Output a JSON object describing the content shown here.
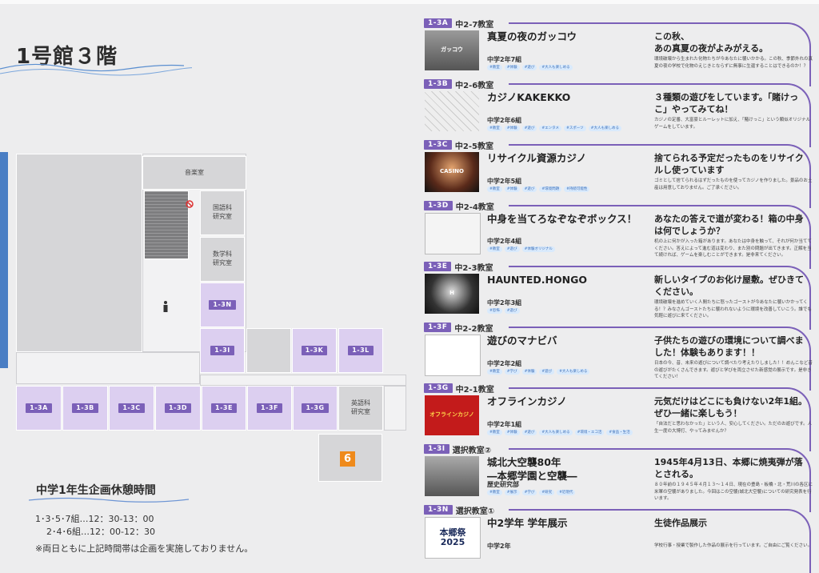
{
  "floor_title": "1号館３階",
  "colors": {
    "accent": "#7b60b8",
    "room_tag": "#dccff0",
    "marker": "#ef8a1b",
    "blue": "#4a7ec4"
  },
  "map": {
    "rooms": {
      "music": "音楽室",
      "japanese": "国語科\n研究室",
      "math": "数学科\n研究室",
      "english": "英語科\n研究室"
    },
    "tags": [
      "1-3N",
      "1-3I",
      "1-3K",
      "1-3L",
      "1-3A",
      "1-3B",
      "1-3C",
      "1-3D",
      "1-3E",
      "1-3F",
      "1-3G"
    ],
    "marker": "6",
    "icons": [
      "person-icon",
      "no-entry-icon"
    ]
  },
  "break_info": {
    "title": "中学1年生企画休憩時間",
    "line1": "1･3･5･7組…12：30-13：00",
    "line2": "2･4･6組…12：00-12：30",
    "note": "※両日ともに上記時間帯は企画を実施しておりません。"
  },
  "entries": [
    {
      "tag": "1-3A",
      "room": "中2-7教室",
      "title": "真夏の夜のガッコウ",
      "cls": "中学2年7組",
      "chips": [
        "#教室",
        "#体験",
        "#遊び",
        "#大人も楽しめる"
      ],
      "headline": "この秋、\nあの真夏の夜がよみがえる。",
      "desc": "環境破壊から生まれた化物たちが今あなたに襲いかかる。この秋、季節外れの真夏の夜の学校で化物のえじきとならずに無事に生還することはできるのか！？",
      "thumb_text": "ガッコウ"
    },
    {
      "tag": "1-3B",
      "room": "中2-6教室",
      "title": "カジノKAKEKKO",
      "cls": "中学2年6組",
      "chips": [
        "#教室",
        "#体験",
        "#遊び",
        "#エンタメ",
        "#スポーツ",
        "#大人も楽しめる"
      ],
      "headline": "３種類の遊びをしています。「賭けっこ」やってみてね！",
      "desc": "カジノの定番、大富豪とルーレットに加え、「賭けっこ」という類似オリジナルゲームをしています。",
      "thumb_text": ""
    },
    {
      "tag": "1-3C",
      "room": "中2-5教室",
      "title": "リサイクル資源カジノ",
      "cls": "中学2年5組",
      "chips": [
        "#教室",
        "#体験",
        "#遊び",
        "#環境問題",
        "#持続可能性"
      ],
      "headline": "捨てられる予定だったものをリサイクルし使っています",
      "desc": "ゴミとして捨てられるはずだったものを使ってカジノを作りました。景品のお土産は用意しておりません。ご了承ください。",
      "thumb_text": "CASINO"
    },
    {
      "tag": "1-3D",
      "room": "中2-4教室",
      "title": "中身を当てろなぞなぞボックス！",
      "cls": "中学2年4組",
      "chips": [
        "#教室",
        "#遊び",
        "#体験オリジナル"
      ],
      "headline": "あなたの答えで道が変わる！箱の中身は何でしょうか？",
      "desc": "机の上に何かが入った箱があります。あなたは中身を触って、それが何か当ててください。答えによって進む道は変わり、また別の問題が出てきます。正解を当て続ければ、ゲームを楽しむことができます。是非来てください。",
      "thumb_text": ""
    },
    {
      "tag": "1-3E",
      "room": "中2-3教室",
      "title": "HAUNTED.HONGO",
      "cls": "中学2年3組",
      "chips": [
        "#恐怖",
        "#遊び"
      ],
      "headline": "新しいタイプのお化け屋敷。ぜひきてください。",
      "desc": "環境破壊を進めていく人間たちに怒ったゴーストが今あなたに襲いかかってくる！？みなさんゴーストたちに襲われないように環境を改善していこう。誰でも気軽に遊びに来てください。",
      "thumb_text": "H"
    },
    {
      "tag": "1-3F",
      "room": "中2-2教室",
      "title": "遊びのマナビバ",
      "cls": "中学2年2組",
      "chips": [
        "#教室",
        "#学び",
        "#体験",
        "#遊び",
        "#大人も楽しめる"
      ],
      "headline": "子供たちの遊びの環境について調べました！体験もあります！！",
      "desc": "日本の今、昔、未来の遊びについて調べたり考えたりしました！！めんこなど昔の遊びがたくさんできます。遊びと学びを両立させた新感覚の展示です。是非きてください！",
      "thumb_text": "遊びの マナビバ"
    },
    {
      "tag": "1-3G",
      "room": "中2-1教室",
      "title": "オフラインカジノ",
      "cls": "中学2年1組",
      "chips": [
        "#教室",
        "#体験",
        "#遊び",
        "#大人も楽しめる",
        "#環境・エコ活",
        "#食品・生活"
      ],
      "headline": "元気だけはどこにも負けない2年1組。ぜひ一緒に楽しもう！",
      "desc": "「自法だと思わなかった」という人、安心してください。ただのお遊びです。人生一度の大博打、やってみませんか？",
      "thumb_text": "オフラインカジノ"
    },
    {
      "tag": "1-3I",
      "room": "選択教室②",
      "title": "城北大空襲80年\n―本郷学園と空襲―",
      "cls": "歴史研究部",
      "chips": [
        "#教室",
        "#展示",
        "#学び",
        "#研究",
        "#近現代"
      ],
      "headline": "1945年4月13日、本郷に焼夷弾が落とされる。",
      "desc": "８０年前の１９４５年４月１３～１４日、現在の豊島・板橋・北・荒川の各区に米軍の空襲がありました。今回はこの空襲(城北大空襲)についての研究発表を行います。",
      "thumb_text": ""
    },
    {
      "tag": "1-3N",
      "room": "選択教室①",
      "title": "中2学年 学年展示",
      "cls": "中学2年",
      "chips": [],
      "headline": "生徒作品展示",
      "desc": "学校行事・授業で製作した作品の展示を行っています。ご自由にご覧ください。",
      "thumb_text": "本郷祭\n2025"
    }
  ]
}
